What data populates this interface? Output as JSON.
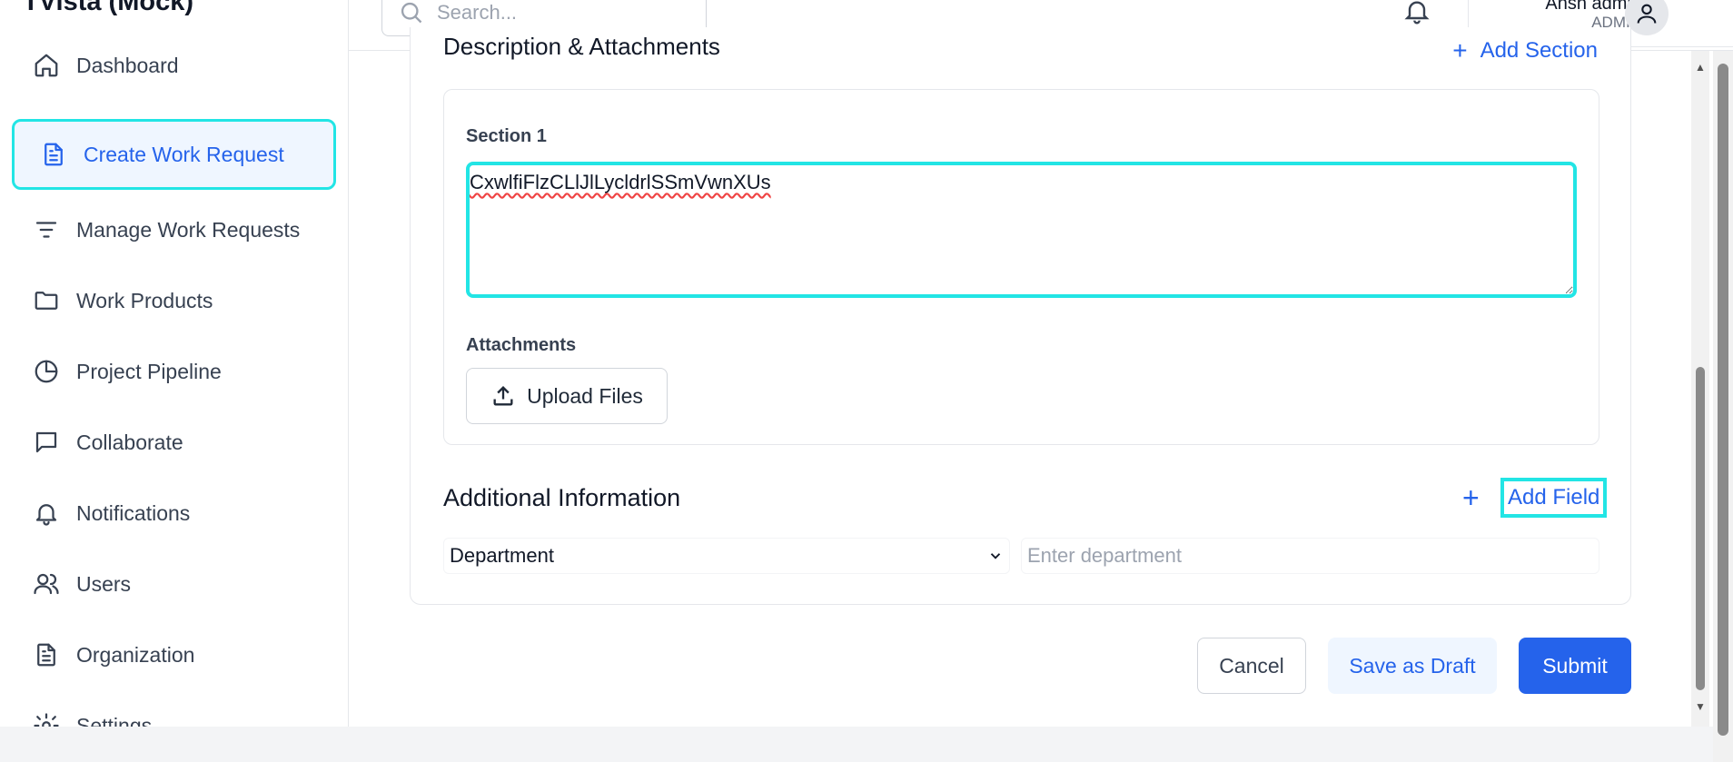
{
  "app": {
    "title": "TVista (Mock)"
  },
  "sidebar": {
    "items": [
      {
        "label": "Dashboard",
        "icon": "home-icon"
      },
      {
        "label": "Create Work Request",
        "icon": "document-icon",
        "active": true
      },
      {
        "label": "Manage Work Requests",
        "icon": "filter-icon"
      },
      {
        "label": "Work Products",
        "icon": "folder-icon"
      },
      {
        "label": "Project Pipeline",
        "icon": "pie-chart-icon"
      },
      {
        "label": "Collaborate",
        "icon": "chat-icon"
      },
      {
        "label": "Notifications",
        "icon": "bell-icon"
      },
      {
        "label": "Users",
        "icon": "users-icon"
      },
      {
        "label": "Organization",
        "icon": "document-icon"
      },
      {
        "label": "Settings",
        "icon": "gear-icon"
      }
    ]
  },
  "header": {
    "search_placeholder": "Search...",
    "user_name": "Ansh  admin",
    "user_role": "ADMIN"
  },
  "form": {
    "description_title": "Description & Attachments",
    "add_section_label": "Add Section",
    "section_label": "Section 1",
    "section_text": "CxwlfiFlzCLlJlLycldrlSSmVwnXUs",
    "attachments_label": "Attachments",
    "upload_label": "Upload Files",
    "additional_title": "Additional Information",
    "add_field_label": "Add Field",
    "department_select": "Department",
    "department_placeholder": "Enter department"
  },
  "actions": {
    "cancel": "Cancel",
    "save_draft": "Save as Draft",
    "submit": "Submit"
  },
  "colors": {
    "accent": "#2563eb",
    "focus_outline": "#22e5e5",
    "active_bg": "#eff6ff"
  }
}
